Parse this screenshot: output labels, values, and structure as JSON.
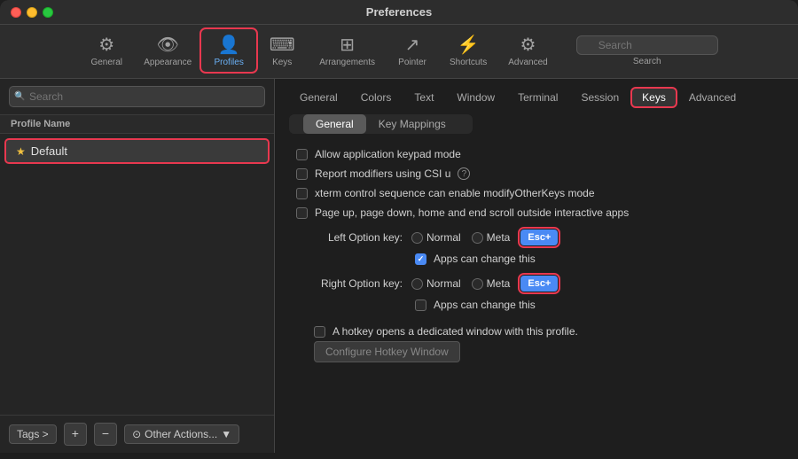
{
  "window": {
    "title": "Preferences"
  },
  "toolbar": {
    "items": [
      {
        "id": "general",
        "label": "General",
        "icon": "⚙"
      },
      {
        "id": "appearance",
        "label": "Appearance",
        "icon": "👁"
      },
      {
        "id": "profiles",
        "label": "Profiles",
        "icon": "👤",
        "active": true
      },
      {
        "id": "keys",
        "label": "Keys",
        "icon": "⌨"
      },
      {
        "id": "arrangements",
        "label": "Arrangements",
        "icon": "📋"
      },
      {
        "id": "pointer",
        "label": "Pointer",
        "icon": "↗"
      },
      {
        "id": "shortcuts",
        "label": "Shortcuts",
        "icon": "⚡"
      },
      {
        "id": "advanced",
        "label": "Advanced",
        "icon": "⚙"
      }
    ],
    "search_placeholder": "Search",
    "search_label": "Search"
  },
  "sidebar": {
    "search_placeholder": "Search",
    "list_header": "Profile Name",
    "profiles": [
      {
        "id": "default",
        "name": "Default",
        "is_default": true,
        "selected": true
      }
    ],
    "footer": {
      "tags_label": "Tags >",
      "add_label": "+",
      "remove_label": "−",
      "other_actions_label": "⊙ Other Actions...",
      "dropdown_icon": "▼"
    }
  },
  "content": {
    "tabs": [
      {
        "id": "general",
        "label": "General"
      },
      {
        "id": "colors",
        "label": "Colors"
      },
      {
        "id": "text",
        "label": "Text"
      },
      {
        "id": "window",
        "label": "Window"
      },
      {
        "id": "terminal",
        "label": "Terminal"
      },
      {
        "id": "session",
        "label": "Session"
      },
      {
        "id": "keys",
        "label": "Keys",
        "active": true
      },
      {
        "id": "advanced",
        "label": "Advanced"
      }
    ],
    "subtabs": [
      {
        "id": "general",
        "label": "General",
        "active": true
      },
      {
        "id": "key-mappings",
        "label": "Key Mappings"
      }
    ],
    "checkboxes": [
      {
        "id": "allow-keypad",
        "label": "Allow application keypad mode",
        "checked": false
      },
      {
        "id": "report-modifiers",
        "label": "Report modifiers using CSI u",
        "checked": false,
        "has_help": true
      },
      {
        "id": "xterm-control",
        "label": "xterm control sequence can enable modifyOtherKeys mode",
        "checked": false
      },
      {
        "id": "page-scroll",
        "label": "Page up, page down, home and end scroll outside interactive apps",
        "checked": false
      }
    ],
    "left_option_key": {
      "label": "Left Option key:",
      "options": [
        {
          "id": "normal",
          "label": "Normal",
          "checked": false
        },
        {
          "id": "meta",
          "label": "Meta",
          "checked": false
        },
        {
          "id": "esc",
          "label": "Esc+",
          "checked": true
        }
      ],
      "apps_can_change": true,
      "apps_can_change_label": "Apps can change this"
    },
    "right_option_key": {
      "label": "Right Option key:",
      "options": [
        {
          "id": "normal",
          "label": "Normal",
          "checked": false
        },
        {
          "id": "meta",
          "label": "Meta",
          "checked": false
        },
        {
          "id": "esc",
          "label": "Esc+",
          "checked": true
        }
      ],
      "apps_can_change": false,
      "apps_can_change_label": "Apps can change this"
    },
    "hotkey": {
      "label": "A hotkey opens a dedicated window with this profile.",
      "checked": false,
      "configure_btn_label": "Configure Hotkey Window"
    }
  }
}
